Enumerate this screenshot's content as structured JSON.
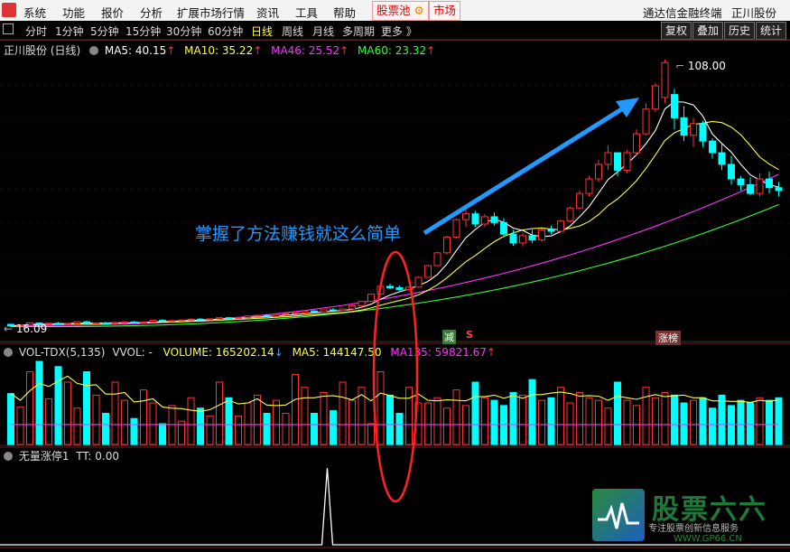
{
  "menubar": {
    "items": [
      "系统",
      "功能",
      "报价",
      "分析",
      "扩展市场行情",
      "资讯",
      "工具",
      "帮助"
    ],
    "pill_pool": "股票池",
    "pill_market": "市场",
    "brand": "通达信金融终端",
    "stock_name": "正川股份"
  },
  "periodbar": {
    "periods": [
      "分时",
      "1分钟",
      "5分钟",
      "15分钟",
      "30分钟",
      "60分钟",
      "日线",
      "周线",
      "月线",
      "多周期",
      "更多 》"
    ],
    "active_index": 6,
    "tools": [
      "复权",
      "叠加",
      "历史",
      "统计"
    ]
  },
  "price_panel": {
    "title": "正川股份 (日线)",
    "ma5": "MA5: 40.15",
    "ma10": "MA10: 35.22",
    "ma46": "MA46: 25.52",
    "ma60": "MA60: 23.32",
    "high_label": "108.00",
    "low_label": "16.09",
    "annotation": "掌握了方法赚钱就这么简单",
    "marker_jian": "减",
    "marker_s": "S",
    "marker_zhangbang": "涨榜"
  },
  "volume_panel": {
    "title": "VOL-TDX(5,135)",
    "vvol": "VVOL: -",
    "volume": "VOLUME: 165202.14",
    "ma5": "MA5: 144147.50",
    "ma135": "MA135: 59821.67"
  },
  "indicator_panel": {
    "title": "无量涨停1",
    "tt": "TT: 0.00"
  },
  "watermark": {
    "name": "股票六六",
    "slogan": "专注股票创新信息服务",
    "url": "WWW.GP66.CN"
  },
  "colors": {
    "up": "#ff3333",
    "down": "#00ffff",
    "ma5": "#ffffff",
    "ma10": "#ffff44",
    "ma46": "#ff33ff",
    "ma60": "#33ff33",
    "annotation": "#2299ff",
    "highlight_ellipse": "#ff2222"
  },
  "chart_data": {
    "type": "candlestick",
    "title": "正川股份 (日线)",
    "price_range": [
      16.09,
      108.0
    ],
    "candles": [
      [
        17.0,
        17.3,
        16.1,
        16.5
      ],
      [
        16.5,
        16.9,
        16.2,
        16.8
      ],
      [
        16.8,
        17.6,
        16.6,
        17.5
      ],
      [
        17.5,
        17.6,
        17.0,
        17.2
      ],
      [
        17.2,
        17.5,
        16.9,
        17.4
      ],
      [
        17.4,
        17.8,
        17.1,
        17.1
      ],
      [
        17.1,
        17.5,
        16.8,
        17.3
      ],
      [
        17.3,
        18.0,
        17.2,
        17.9
      ],
      [
        17.9,
        18.3,
        17.2,
        17.4
      ],
      [
        17.4,
        17.7,
        17.0,
        17.5
      ],
      [
        17.5,
        17.9,
        17.2,
        17.3
      ],
      [
        17.3,
        17.7,
        17.1,
        17.6
      ],
      [
        17.6,
        18.1,
        17.4,
        17.8
      ],
      [
        17.8,
        18.2,
        17.4,
        17.5
      ],
      [
        17.5,
        17.9,
        17.2,
        17.8
      ],
      [
        17.8,
        18.6,
        17.6,
        18.4
      ],
      [
        18.4,
        18.8,
        18.0,
        18.1
      ],
      [
        18.1,
        18.5,
        17.8,
        18.3
      ],
      [
        18.3,
        18.7,
        18.0,
        18.5
      ],
      [
        18.5,
        19.0,
        18.2,
        18.8
      ],
      [
        18.8,
        19.2,
        18.4,
        18.6
      ],
      [
        18.6,
        19.0,
        18.3,
        18.9
      ],
      [
        18.9,
        19.5,
        18.7,
        19.3
      ],
      [
        19.3,
        19.6,
        18.9,
        19.1
      ],
      [
        19.1,
        19.5,
        18.8,
        19.4
      ],
      [
        19.4,
        20.1,
        19.2,
        19.9
      ],
      [
        19.9,
        20.4,
        19.6,
        20.1
      ],
      [
        20.1,
        20.5,
        19.7,
        19.8
      ],
      [
        19.8,
        20.6,
        19.7,
        20.4
      ],
      [
        20.4,
        21.0,
        20.2,
        20.7
      ],
      [
        20.7,
        21.1,
        20.4,
        20.9
      ],
      [
        20.9,
        21.8,
        20.8,
        21.6
      ],
      [
        21.6,
        21.9,
        21.1,
        21.3
      ],
      [
        21.3,
        22.1,
        21.2,
        22.0
      ],
      [
        22.0,
        22.6,
        21.7,
        21.8
      ],
      [
        21.8,
        22.5,
        21.6,
        22.3
      ],
      [
        22.3,
        23.6,
        22.2,
        23.4
      ],
      [
        23.4,
        25.0,
        23.3,
        24.9
      ],
      [
        24.9,
        27.5,
        24.8,
        27.4
      ],
      [
        27.4,
        30.2,
        27.3,
        30.1
      ],
      [
        30.1,
        31.0,
        29.2,
        29.6
      ],
      [
        29.6,
        30.3,
        28.5,
        29.0
      ],
      [
        29.0,
        30.0,
        28.6,
        29.8
      ],
      [
        29.8,
        33.5,
        29.6,
        33.2
      ],
      [
        33.2,
        37.5,
        33.0,
        37.2
      ],
      [
        37.2,
        42.0,
        37.0,
        41.6
      ],
      [
        41.6,
        47.5,
        41.0,
        47.0
      ],
      [
        47.0,
        53.5,
        46.5,
        53.0
      ],
      [
        53.0,
        57.5,
        50.5,
        55.0
      ],
      [
        55.0,
        56.0,
        50.5,
        51.5
      ],
      [
        51.5,
        55.0,
        50.5,
        54.0
      ],
      [
        54.0,
        55.5,
        51.0,
        52.0
      ],
      [
        52.0,
        53.5,
        47.0,
        48.0
      ],
      [
        48.0,
        49.5,
        44.0,
        45.0
      ],
      [
        45.0,
        48.5,
        43.8,
        47.5
      ],
      [
        47.5,
        49.5,
        45.0,
        46.0
      ],
      [
        46.0,
        50.0,
        45.5,
        49.5
      ],
      [
        49.5,
        51.0,
        48.0,
        49.0
      ],
      [
        49.0,
        53.0,
        48.5,
        52.5
      ],
      [
        52.5,
        57.5,
        52.0,
        57.0
      ],
      [
        57.0,
        63.0,
        56.5,
        62.0
      ],
      [
        62.0,
        68.0,
        61.0,
        67.0
      ],
      [
        67.0,
        73.5,
        66.0,
        72.0
      ],
      [
        72.0,
        78.5,
        70.0,
        76.0
      ],
      [
        76.0,
        74.0,
        68.0,
        70.0
      ],
      [
        70.0,
        77.0,
        69.0,
        76.0
      ],
      [
        76.0,
        84.0,
        75.0,
        82.5
      ],
      [
        82.5,
        93.0,
        82.0,
        91.0
      ],
      [
        91.0,
        100.0,
        90.0,
        99.0
      ],
      [
        95.0,
        108.0,
        93.0,
        107.0
      ],
      [
        96.0,
        98.0,
        84.0,
        88.0
      ],
      [
        88.0,
        92.0,
        80.0,
        82.0
      ],
      [
        82.0,
        88.0,
        78.0,
        86.0
      ],
      [
        86.0,
        87.0,
        78.0,
        80.0
      ],
      [
        80.0,
        81.0,
        74.0,
        76.0
      ],
      [
        76.0,
        79.0,
        70.0,
        72.0
      ],
      [
        72.0,
        75.0,
        65.0,
        67.0
      ],
      [
        67.0,
        68.0,
        63.0,
        65.0
      ],
      [
        65.0,
        67.5,
        61.5,
        62.0
      ],
      [
        62.0,
        69.0,
        61.0,
        67.0
      ],
      [
        67.0,
        69.5,
        62.0,
        64.0
      ],
      [
        64.0,
        66.0,
        61.0,
        63.0
      ]
    ],
    "volume": [
      98,
      72,
      140,
      160,
      88,
      150,
      120,
      70,
      140,
      95,
      60,
      120,
      85,
      50,
      105,
      80,
      40,
      75,
      45,
      90,
      70,
      55,
      120,
      90,
      55,
      80,
      95,
      60,
      85,
      60,
      135,
      110,
      60,
      100,
      65,
      120,
      85,
      110,
      40,
      140,
      95,
      60,
      110,
      80,
      80,
      90,
      70,
      105,
      75,
      120,
      90,
      85,
      75,
      100,
      95,
      125,
      85,
      90,
      110,
      80,
      100,
      90,
      85,
      70,
      120,
      85,
      75,
      110,
      90,
      100,
      95,
      80,
      85,
      90,
      70,
      95,
      75,
      85,
      80,
      90,
      85,
      90
    ],
    "tt_spike_index": 33,
    "tt_spike_value": 1
  }
}
